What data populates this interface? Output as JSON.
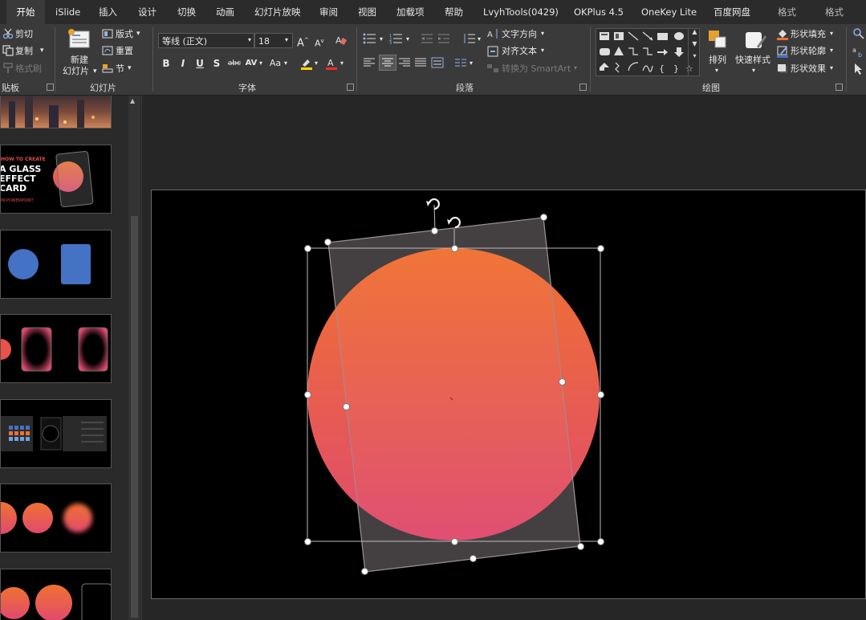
{
  "tabs": [
    "开始",
    "iSlide",
    "插入",
    "设计",
    "切换",
    "动画",
    "幻灯片放映",
    "审阅",
    "视图",
    "加载项",
    "帮助",
    "LvyhTools(0429)",
    "OKPlus 4.5",
    "OneKey Lite",
    "百度网盘",
    "格式",
    "格式"
  ],
  "clipboard": {
    "cut": "剪切",
    "copy": "复制",
    "format_painter": "格式刷",
    "group": "贴板"
  },
  "slides_group": {
    "new_slide": "新建",
    "new_slide_2": "幻灯片",
    "layout": "版式",
    "reset": "重置",
    "section": "节",
    "group": "幻灯片"
  },
  "font": {
    "name": "等线 (正文)",
    "size": "18",
    "bold": "B",
    "italic": "I",
    "underline": "U",
    "shadow": "S",
    "strike": "abc",
    "spacing": "AV",
    "case": "Aa",
    "group": "字体"
  },
  "paragraph": {
    "text_direction": "文字方向",
    "align_text": "对齐文本",
    "smartart": "转换为 SmartArt",
    "group": "段落"
  },
  "drawing": {
    "arrange": "排列",
    "quick_styles": "快速样式",
    "shape_fill": "形状填充",
    "shape_outline": "形状轮廓",
    "shape_effects": "形状效果",
    "group": "绘图"
  },
  "thumbnails": {
    "slide2_line1": "HOW TO CREATE",
    "slide2_line2": "A GLASS",
    "slide2_line3": "EFFECT",
    "slide2_line4": "CARD",
    "slide2_line5": "IN POWERPOINT"
  },
  "colors": {
    "accent_top": "#f07131",
    "accent_bottom": "#e04a6e",
    "blue_shape": "#4472c4"
  }
}
